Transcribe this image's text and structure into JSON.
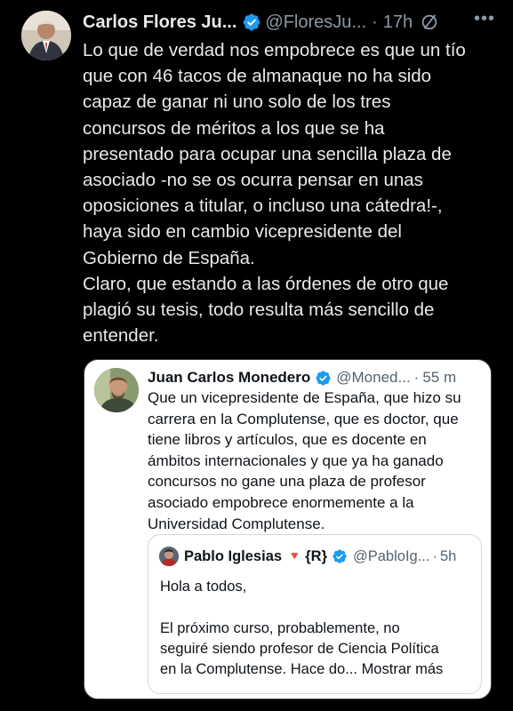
{
  "tweet": {
    "author_name": "Carlos Flores Ju...",
    "author_handle": "@FloresJu...",
    "separator": "·",
    "time": "17h",
    "more_icon": "more-icon",
    "body": "Lo que de verdad nos empobrece es que un tío\nque con 46 tacos de almanaque no ha sido\ncapaz de ganar ni uno solo de los tres\nconcursos de méritos a los que se ha\npresentado para ocupar una sencilla plaza de\nasociado -no se os ocurra pensar en unas\noposiciones a titular, o incluso una cátedra!-,\nhaya sido en cambio vicepresidente del\nGobierno de España.\nClaro, que estando a las órdenes de otro que\nplagió su tesis, todo resulta  más sencillo de\nentender."
  },
  "quoted": {
    "author_name": "Juan Carlos Monedero",
    "author_handle": "@Moned...",
    "separator": "·",
    "time": "55 m",
    "body": "Que un vicepresidente de España, que hizo su\ncarrera en la Complutense, que es doctor, que\ntiene libros y artículos, que es docente en\námbitos internacionales y que ya ha ganado\nconcursos no gane una plaza de profesor\nasociado empobrece enormemente a la\nUniversidad Complutense."
  },
  "nested_quote": {
    "author_name": "Pablo Iglesias",
    "flag": "🔻",
    "badge": "{R}",
    "author_handle": "@PabloIg...",
    "separator": "·",
    "time": "5h",
    "body_line1": "Hola a todos,",
    "body_rest": "El próximo curso, probablemente, no\nseguiré siendo profesor de Ciencia Política\nen la Complutense. Hace do...",
    "show_more": "Mostrar más"
  },
  "colors": {
    "background": "#000000",
    "verified": "#1d9bf0",
    "secondary_text": "#8b98a5"
  }
}
